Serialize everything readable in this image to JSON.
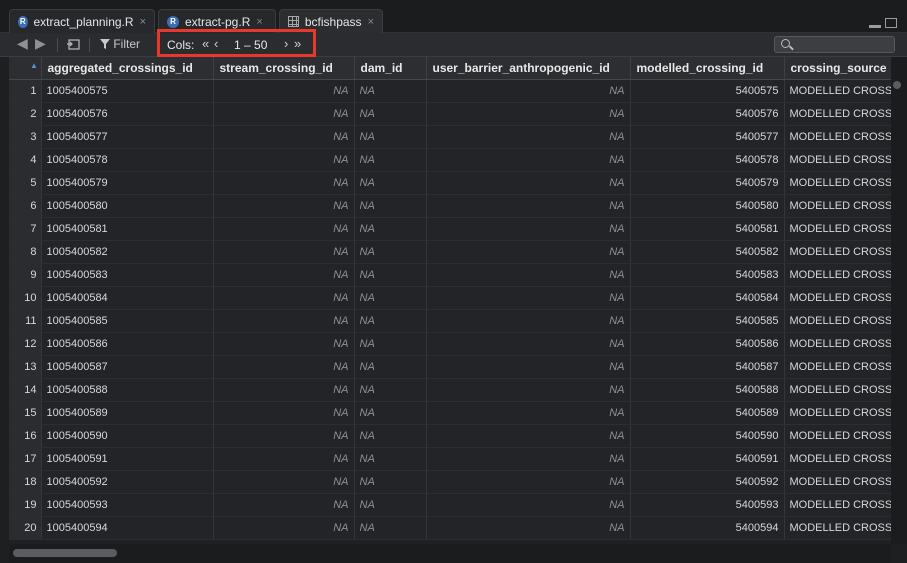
{
  "tabs": [
    {
      "label": "extract_planning.R",
      "close": "×",
      "icon": "r-file-icon"
    },
    {
      "label": "extract-pg.R",
      "close": "×",
      "icon": "r-file-icon"
    },
    {
      "label": "bcfishpass",
      "close": "×",
      "icon": "data-grid-icon"
    }
  ],
  "toolbar": {
    "filter_label": "Filter",
    "cols_label": "Cols:",
    "first_cols": "«",
    "prev_cols": "‹",
    "cols_range": "1 – 50",
    "next_cols": "›",
    "last_cols": "»",
    "search_placeholder": ""
  },
  "table": {
    "columns": [
      "",
      "aggregated_crossings_id",
      "stream_crossing_id",
      "dam_id",
      "user_barrier_anthropogenic_id",
      "modelled_crossing_id",
      "crossing_source"
    ],
    "rows": [
      {
        "n": "1",
        "agg": "1005400575",
        "stream": "NA",
        "dam": "NA",
        "user": "NA",
        "modelled": "5400575",
        "source": "MODELLED CROSSI"
      },
      {
        "n": "2",
        "agg": "1005400576",
        "stream": "NA",
        "dam": "NA",
        "user": "NA",
        "modelled": "5400576",
        "source": "MODELLED CROSSI"
      },
      {
        "n": "3",
        "agg": "1005400577",
        "stream": "NA",
        "dam": "NA",
        "user": "NA",
        "modelled": "5400577",
        "source": "MODELLED CROSSI"
      },
      {
        "n": "4",
        "agg": "1005400578",
        "stream": "NA",
        "dam": "NA",
        "user": "NA",
        "modelled": "5400578",
        "source": "MODELLED CROSSI"
      },
      {
        "n": "5",
        "agg": "1005400579",
        "stream": "NA",
        "dam": "NA",
        "user": "NA",
        "modelled": "5400579",
        "source": "MODELLED CROSSI"
      },
      {
        "n": "6",
        "agg": "1005400580",
        "stream": "NA",
        "dam": "NA",
        "user": "NA",
        "modelled": "5400580",
        "source": "MODELLED CROSSI"
      },
      {
        "n": "7",
        "agg": "1005400581",
        "stream": "NA",
        "dam": "NA",
        "user": "NA",
        "modelled": "5400581",
        "source": "MODELLED CROSSI"
      },
      {
        "n": "8",
        "agg": "1005400582",
        "stream": "NA",
        "dam": "NA",
        "user": "NA",
        "modelled": "5400582",
        "source": "MODELLED CROSSI"
      },
      {
        "n": "9",
        "agg": "1005400583",
        "stream": "NA",
        "dam": "NA",
        "user": "NA",
        "modelled": "5400583",
        "source": "MODELLED CROSSI"
      },
      {
        "n": "10",
        "agg": "1005400584",
        "stream": "NA",
        "dam": "NA",
        "user": "NA",
        "modelled": "5400584",
        "source": "MODELLED CROSSI"
      },
      {
        "n": "11",
        "agg": "1005400585",
        "stream": "NA",
        "dam": "NA",
        "user": "NA",
        "modelled": "5400585",
        "source": "MODELLED CROSSI"
      },
      {
        "n": "12",
        "agg": "1005400586",
        "stream": "NA",
        "dam": "NA",
        "user": "NA",
        "modelled": "5400586",
        "source": "MODELLED CROSSI"
      },
      {
        "n": "13",
        "agg": "1005400587",
        "stream": "NA",
        "dam": "NA",
        "user": "NA",
        "modelled": "5400587",
        "source": "MODELLED CROSSI"
      },
      {
        "n": "14",
        "agg": "1005400588",
        "stream": "NA",
        "dam": "NA",
        "user": "NA",
        "modelled": "5400588",
        "source": "MODELLED CROSSI"
      },
      {
        "n": "15",
        "agg": "1005400589",
        "stream": "NA",
        "dam": "NA",
        "user": "NA",
        "modelled": "5400589",
        "source": "MODELLED CROSSI"
      },
      {
        "n": "16",
        "agg": "1005400590",
        "stream": "NA",
        "dam": "NA",
        "user": "NA",
        "modelled": "5400590",
        "source": "MODELLED CROSSI"
      },
      {
        "n": "17",
        "agg": "1005400591",
        "stream": "NA",
        "dam": "NA",
        "user": "NA",
        "modelled": "5400591",
        "source": "MODELLED CROSSI"
      },
      {
        "n": "18",
        "agg": "1005400592",
        "stream": "NA",
        "dam": "NA",
        "user": "NA",
        "modelled": "5400592",
        "source": "MODELLED CROSSI"
      },
      {
        "n": "19",
        "agg": "1005400593",
        "stream": "NA",
        "dam": "NA",
        "user": "NA",
        "modelled": "5400593",
        "source": "MODELLED CROSSI"
      },
      {
        "n": "20",
        "agg": "1005400594",
        "stream": "NA",
        "dam": "NA",
        "user": "NA",
        "modelled": "5400594",
        "source": "MODELLED CROSSI"
      }
    ]
  },
  "colors": {
    "highlight_box": "#e8382b",
    "sort_indicator": "#5b8fd6",
    "r_icon": "#3b6fb4"
  }
}
